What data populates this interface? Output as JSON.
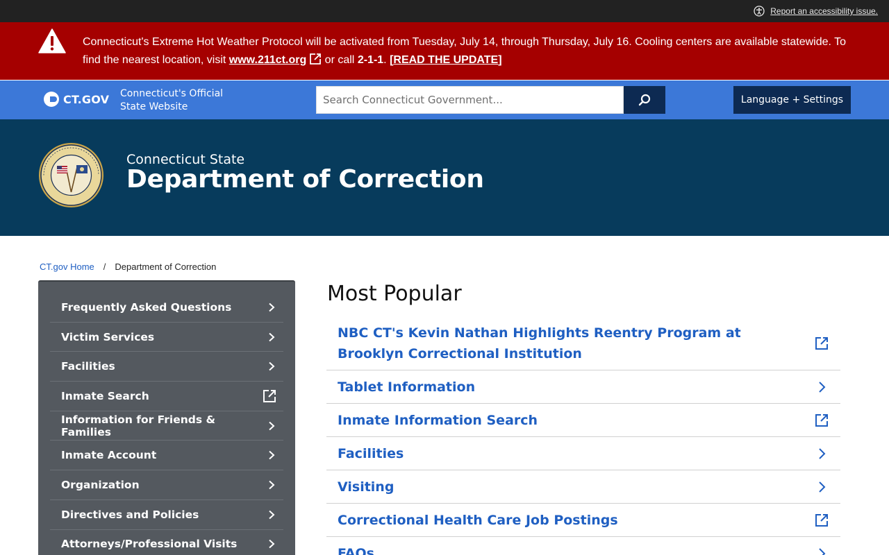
{
  "accessibility": {
    "link_text": "Report an accessibility issue."
  },
  "alert": {
    "text_before": "Connecticut's Extreme Hot Weather Protocol will be activated from Tuesday, July 14, through Thursday, July 16. Cooling centers are available statewide. To find the nearest location, visit ",
    "link_text": "www.211ct.org",
    "text_middle": " or call ",
    "phone": "2-1-1",
    "text_after": ". ",
    "read_update_open": "[",
    "read_update": "READ THE UPDATE",
    "read_update_close": "]"
  },
  "header": {
    "wordmark": "CT.GOV",
    "tagline_line1": "Connecticut's Official",
    "tagline_line2": "State Website",
    "search_placeholder": "Search Connecticut Government...",
    "language_button": "Language + Settings"
  },
  "agency": {
    "subtitle": "Connecticut State",
    "title": "Department of Correction"
  },
  "breadcrumb": {
    "home": "CT.gov Home",
    "separator": "/",
    "current": "Department of Correction"
  },
  "sidebar": {
    "items": [
      {
        "label": "Frequently Asked Questions",
        "icon": "chevron-right-icon"
      },
      {
        "label": "Victim Services",
        "icon": "chevron-right-icon"
      },
      {
        "label": "Facilities",
        "icon": "chevron-right-icon"
      },
      {
        "label": "Inmate Search",
        "icon": "external-link-icon"
      },
      {
        "label": "Information for Friends & Families",
        "icon": "chevron-right-icon"
      },
      {
        "label": "Inmate Account",
        "icon": "chevron-right-icon"
      },
      {
        "label": "Organization",
        "icon": "chevron-right-icon"
      },
      {
        "label": "Directives and Policies",
        "icon": "chevron-right-icon"
      },
      {
        "label": "Attorneys/Professional Visits",
        "icon": "chevron-right-icon"
      }
    ]
  },
  "main": {
    "title": "Most Popular",
    "items": [
      {
        "label": "NBC CT's Kevin Nathan Highlights Reentry Program at Brooklyn Correctional Institution",
        "icon": "external-link-icon"
      },
      {
        "label": "Tablet Information",
        "icon": "chevron-right-icon"
      },
      {
        "label": "Inmate Information Search",
        "icon": "external-link-icon"
      },
      {
        "label": "Facilities",
        "icon": "chevron-right-icon"
      },
      {
        "label": "Visiting",
        "icon": "chevron-right-icon"
      },
      {
        "label": "Correctional Health Care Job Postings",
        "icon": "external-link-icon"
      },
      {
        "label": "FAQs",
        "icon": "chevron-right-icon"
      }
    ]
  },
  "colors": {
    "alert_red": "#a50000",
    "header_blue": "#3c78d8",
    "navy": "#0d2a52",
    "agency_blue": "#073b5c",
    "sidebar_gray": "#54595f",
    "link_blue": "#1f5fc2"
  }
}
